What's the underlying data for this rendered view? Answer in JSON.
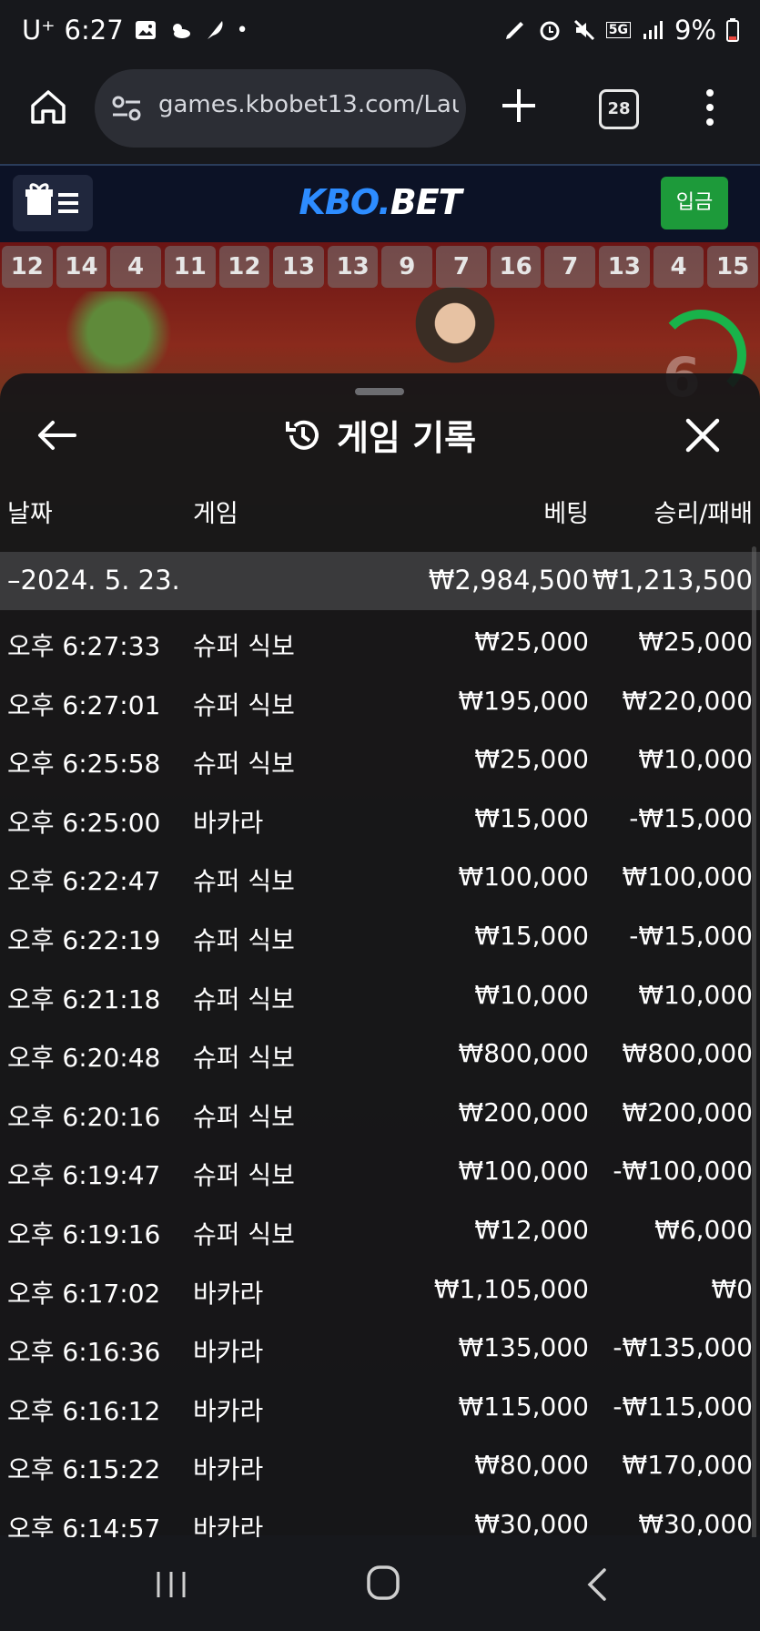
{
  "status_bar": {
    "carrier": "U⁺",
    "time": "6:27",
    "battery": "9%",
    "network": "5G"
  },
  "browser": {
    "url": "games.kbobet13.com/Lau",
    "tab_count": "28"
  },
  "site_header": {
    "logo_part1": "KBO.",
    "logo_part2": "BET",
    "deposit_label": "입금"
  },
  "scoreboard": [
    "12",
    "14",
    "4",
    "11",
    "12",
    "13",
    "13",
    "9",
    "7",
    "16",
    "7",
    "13",
    "4",
    "15"
  ],
  "timer": "6",
  "history": {
    "title": "게임 기록",
    "columns": {
      "date": "날짜",
      "game": "게임",
      "bet": "베팅",
      "result": "승리/패배"
    },
    "summary": {
      "date": "–2024. 5. 23.",
      "bet": "₩2,984,500",
      "result": "₩1,213,500"
    },
    "rows": [
      {
        "time": "오후 6:27:33",
        "game": "슈퍼 식보",
        "bet": "₩25,000",
        "result": "₩25,000"
      },
      {
        "time": "오후 6:27:01",
        "game": "슈퍼 식보",
        "bet": "₩195,000",
        "result": "₩220,000"
      },
      {
        "time": "오후 6:25:58",
        "game": "슈퍼 식보",
        "bet": "₩25,000",
        "result": "₩10,000"
      },
      {
        "time": "오후 6:25:00",
        "game": "바카라",
        "bet": "₩15,000",
        "result": "-₩15,000"
      },
      {
        "time": "오후 6:22:47",
        "game": "슈퍼 식보",
        "bet": "₩100,000",
        "result": "₩100,000"
      },
      {
        "time": "오후 6:22:19",
        "game": "슈퍼 식보",
        "bet": "₩15,000",
        "result": "-₩15,000"
      },
      {
        "time": "오후 6:21:18",
        "game": "슈퍼 식보",
        "bet": "₩10,000",
        "result": "₩10,000"
      },
      {
        "time": "오후 6:20:48",
        "game": "슈퍼 식보",
        "bet": "₩800,000",
        "result": "₩800,000"
      },
      {
        "time": "오후 6:20:16",
        "game": "슈퍼 식보",
        "bet": "₩200,000",
        "result": "₩200,000"
      },
      {
        "time": "오후 6:19:47",
        "game": "슈퍼 식보",
        "bet": "₩100,000",
        "result": "-₩100,000"
      },
      {
        "time": "오후 6:19:16",
        "game": "슈퍼 식보",
        "bet": "₩12,000",
        "result": "₩6,000"
      },
      {
        "time": "오후 6:17:02",
        "game": "바카라",
        "bet": "₩1,105,000",
        "result": "₩0"
      },
      {
        "time": "오후 6:16:36",
        "game": "바카라",
        "bet": "₩135,000",
        "result": "-₩135,000"
      },
      {
        "time": "오후 6:16:12",
        "game": "바카라",
        "bet": "₩115,000",
        "result": "-₩115,000"
      },
      {
        "time": "오후 6:15:22",
        "game": "바카라",
        "bet": "₩80,000",
        "result": "₩170,000"
      },
      {
        "time": "오후 6:14:57",
        "game": "바카라",
        "bet": "₩30,000",
        "result": "₩30,000"
      }
    ]
  }
}
